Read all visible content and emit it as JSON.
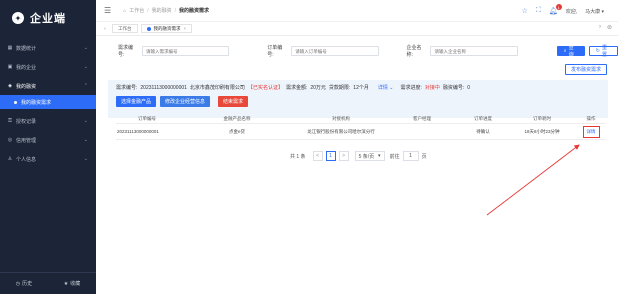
{
  "sidebar": {
    "logo_text": "企业端",
    "items": [
      {
        "label": "数据统计",
        "icon": "grid-icon",
        "arrow": "⌄"
      },
      {
        "label": "我的企业",
        "icon": "building-icon",
        "arrow": "⌄"
      },
      {
        "label": "我的融资",
        "icon": "money-icon",
        "arrow": "⌃"
      },
      {
        "label": "授权记录",
        "icon": "key-icon",
        "arrow": "⌄"
      },
      {
        "label": "信用管理",
        "icon": "shield-icon",
        "arrow": "⌄"
      },
      {
        "label": "个人信息",
        "icon": "user-icon",
        "arrow": "⌄"
      }
    ],
    "active_sub": "我的融资需求",
    "footer": {
      "history": "历史",
      "favorites": "收藏"
    }
  },
  "header": {
    "breadcrumbs": [
      "工作台",
      "我的融资",
      "我的融资需求"
    ],
    "welcome": "欢迎,",
    "user": "马大康",
    "notif_count": "1"
  },
  "tabs": [
    {
      "label": "工作台"
    },
    {
      "label": "我的融资需求"
    }
  ],
  "search": {
    "demand_no_label": "需求编号:",
    "demand_no_placeholder": "请输入需求编号",
    "order_no_label": "订单编号:",
    "order_no_placeholder": "请输入订单编号",
    "company_label": "企业名称:",
    "company_placeholder": "请输入企业名称",
    "query_btn": "查询",
    "reset_btn": "重置"
  },
  "publish_btn": "发布融资需求",
  "summary": {
    "demand_no_label": "需求编号:",
    "demand_no": "20231113000000001",
    "company": "北京市鑫茂印刷有限公司",
    "cert_tag": "【已实名认证】",
    "amount_label": "需求金额:",
    "amount": "20万元",
    "term_label": "贷款期限:",
    "term": "12个月",
    "detail_link": "详情 ⌄",
    "progress_label": "需求进度:",
    "progress": "对接中",
    "fin_no_label": "融资编号:",
    "fin_no": "0",
    "btn_select": "选择金融产品",
    "btn_modify": "修改企业经营信息",
    "btn_end": "结束需求"
  },
  "table": {
    "headers": [
      "订单编号",
      "金融产品名称",
      "对接机构",
      "客户经理",
      "订单进度",
      "订单耗时",
      "操作"
    ],
    "rows": [
      [
        "20231113000000001",
        "点金e贷",
        "龙江银行股份有限公司哈尔滨分行",
        "",
        "待确认",
        "18天8小时23分钟",
        "详情"
      ]
    ]
  },
  "pager": {
    "total": "共 1 条",
    "prev": "<",
    "page": "1",
    "next": ">",
    "page_size": "5 条/页",
    "goto_label": "前往",
    "goto_value": "1",
    "page_unit": "页"
  },
  "colors": {
    "sidebar_bg": "#1c2437",
    "primary": "#2d6cf7",
    "select_btn": "#2d6cf7",
    "modify_btn": "#3a7be8",
    "end_btn": "#e8473a",
    "annotation": "#e53935"
  }
}
